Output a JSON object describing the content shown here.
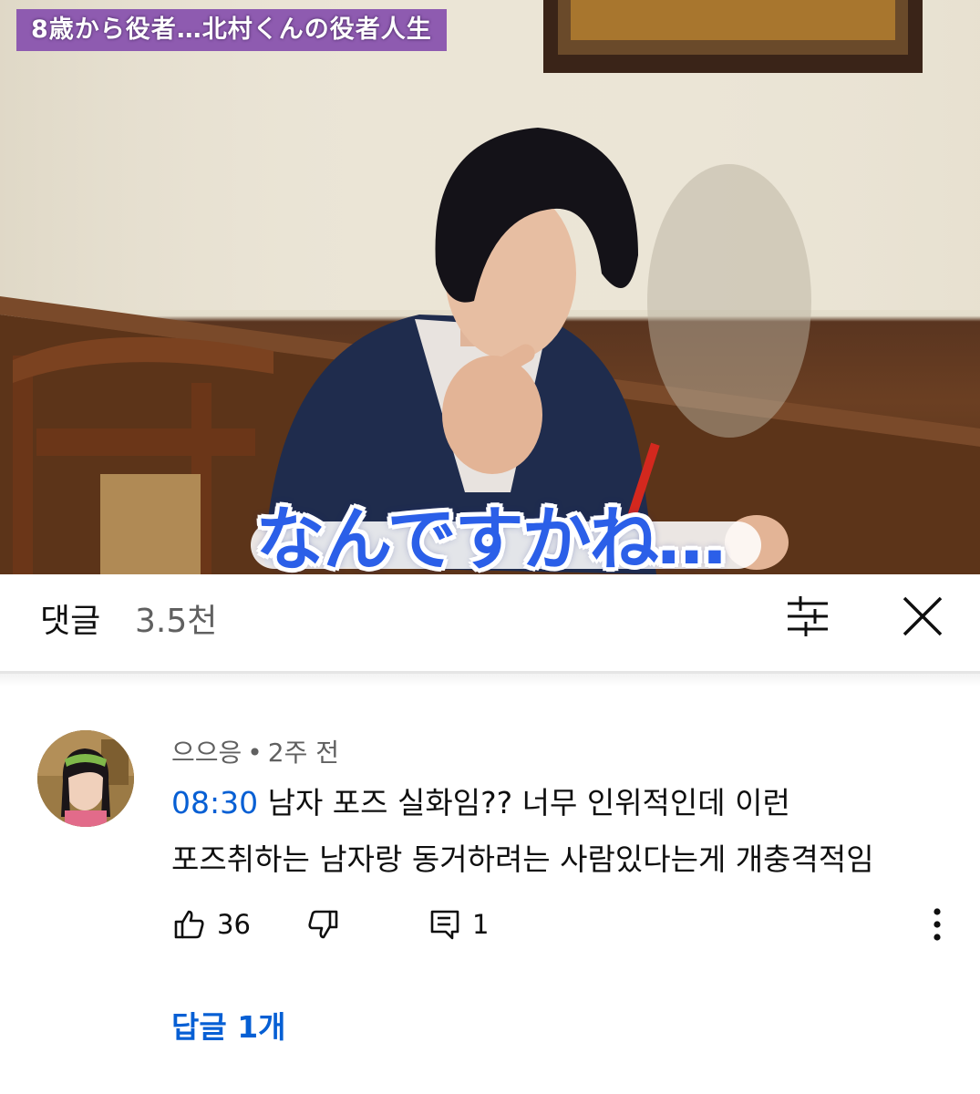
{
  "video": {
    "title_tag": "8歳から役者…北村くんの役者人生",
    "subtitle": "なんですかね…"
  },
  "comments_header": {
    "title": "댓글",
    "count": "3.5천",
    "sort_icon": "sliders-icon",
    "close_icon": "close-icon"
  },
  "comment": {
    "author": "으으응",
    "separator": "•",
    "time": "2주 전",
    "timestamp": "08:30",
    "text_line1": " 남자 포즈 실화임?? 너무 인위적인데 이런",
    "text_line2": "포즈취하는 남자랑 동거하려는 사람있다는게 개충격적임",
    "likes": "36",
    "reply_count": "1",
    "replies_link": "답글 1개"
  },
  "colors": {
    "link_blue": "#065fd4",
    "title_tag_purple": "#8e5bb0",
    "subtitle_blue": "#2b5fe8"
  }
}
